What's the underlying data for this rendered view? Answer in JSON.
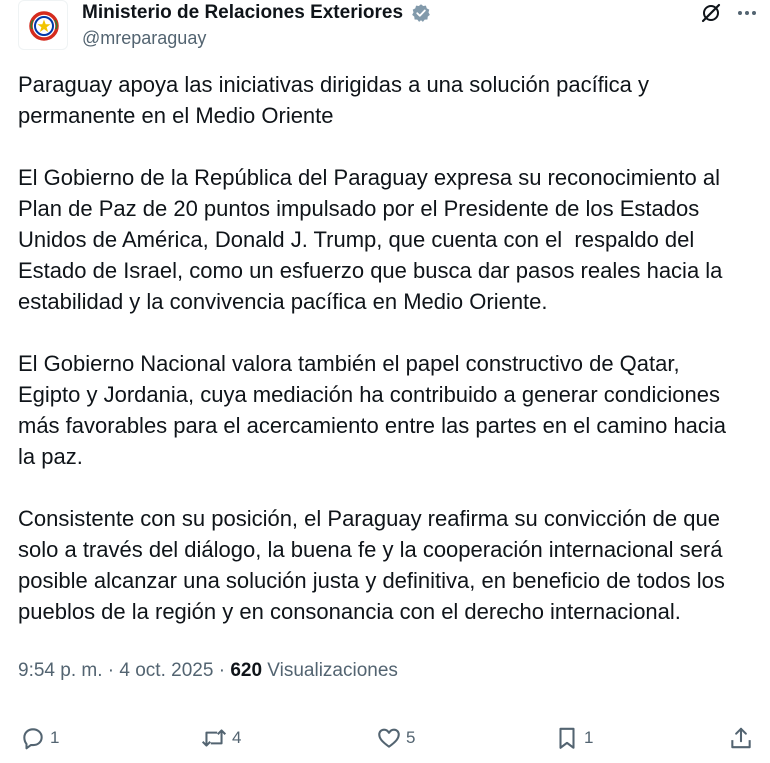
{
  "author": {
    "display_name": "Ministerio de Relaciones Exteriores",
    "handle": "@mreparaguay",
    "avatar_icon": "paraguay-seal-icon",
    "verified_icon": "verified-badge-icon",
    "verified_color": "#829aab"
  },
  "top_actions": {
    "grok_icon": "grok-icon",
    "more_icon": "more-options-icon"
  },
  "tweet": {
    "paragraphs": [
      "Paraguay apoya las iniciativas dirigidas a una solución pacífica y\npermanente en el Medio Oriente",
      "El Gobierno de la República del Paraguay expresa su reconocimiento al\nPlan de Paz de 20 puntos impulsado por el Presidente de los Estados\nUnidos de América, Donald J. Trump, que cuenta con el  respaldo del\nEstado de Israel, como un esfuerzo que busca dar pasos reales hacia la\nestabilidad y la convivencia pacífica en Medio Oriente.",
      "El Gobierno Nacional valora también el papel constructivo de Qatar,\nEgipto y Jordania, cuya mediación ha contribuido a generar condiciones\nmás favorables para el acercamiento entre las partes en el camino hacia\nla paz.",
      "Consistente con su posición, el Paraguay reafirma su convicción de que\nsolo a través del diálogo, la buena fe y la cooperación internacional será\nposible alcanzar una solución justa y definitiva, en beneficio de todos los\npueblos de la región y en consonancia con el derecho internacional."
    ]
  },
  "meta": {
    "time": "9:54 p. m.",
    "separator": " · ",
    "date": "4 oct. 2025",
    "views_count": "620",
    "views_label": "Visualizaciones"
  },
  "actions": {
    "reply": {
      "icon": "reply-icon",
      "count": "1"
    },
    "repost": {
      "icon": "repost-icon",
      "count": "4"
    },
    "like": {
      "icon": "heart-icon",
      "count": "5"
    },
    "bookmark": {
      "icon": "bookmark-icon",
      "count": "1"
    },
    "share": {
      "icon": "share-icon"
    }
  },
  "colors": {
    "text_primary": "#0f1419",
    "text_secondary": "#536471",
    "seal_red": "#d52b1e",
    "seal_blue": "#0038a8",
    "seal_gold": "#f2c400"
  }
}
